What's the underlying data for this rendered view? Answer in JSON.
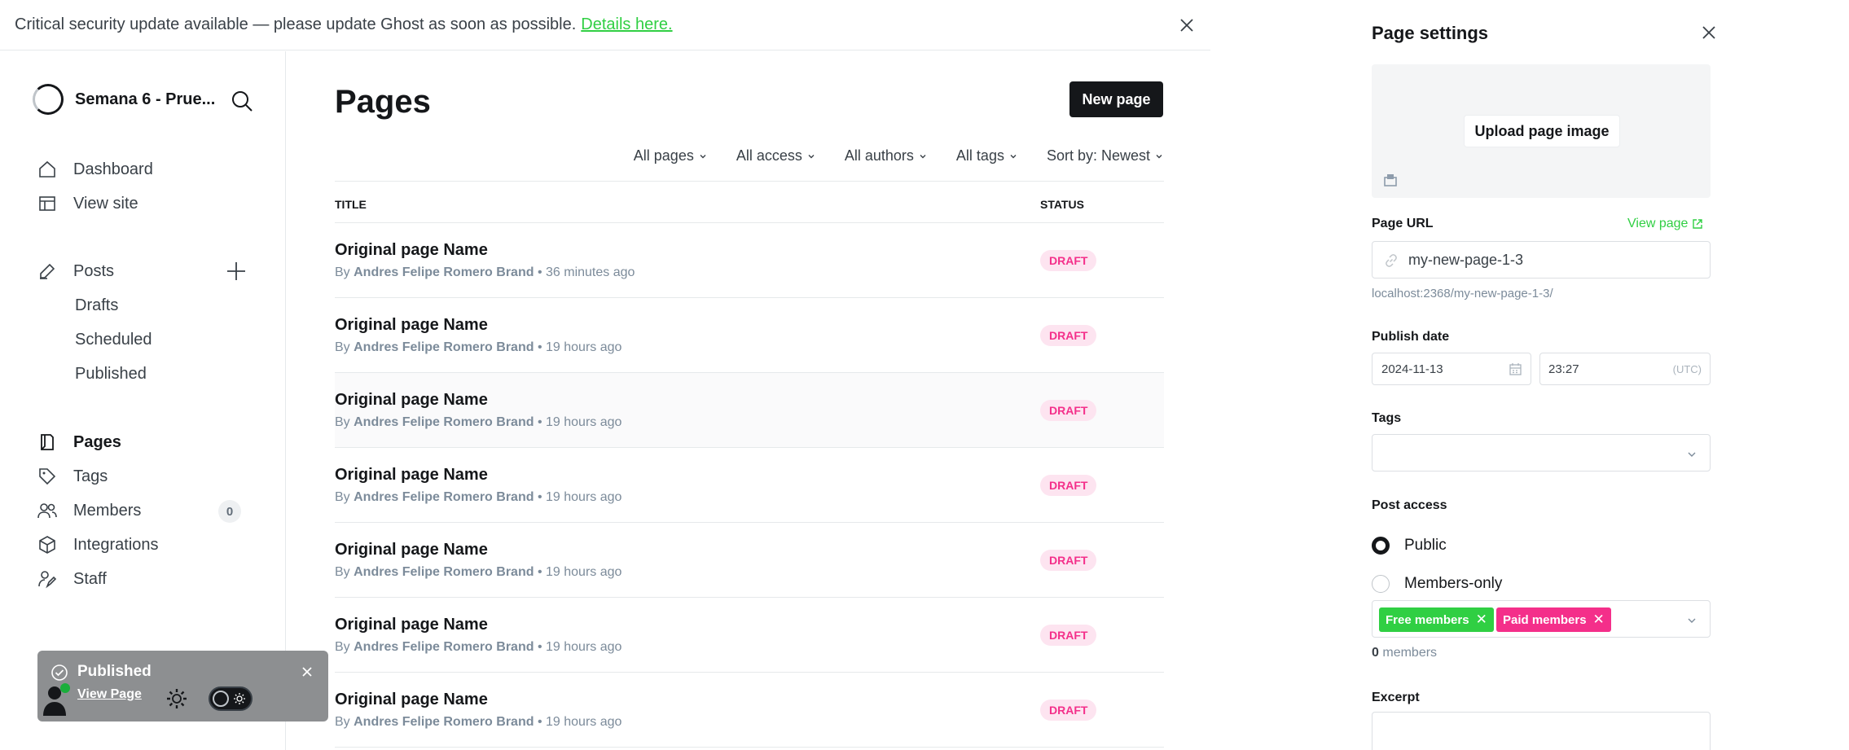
{
  "banner": {
    "text": "Critical security update available — please update Ghost as soon as possible.",
    "link": "Details here."
  },
  "sidebar": {
    "site_name": "Semana 6 - Prue...",
    "items": [
      {
        "label": "Dashboard",
        "icon": "home-icon"
      },
      {
        "label": "View site",
        "icon": "browser-icon"
      },
      {
        "label": "Posts",
        "icon": "pen-icon"
      },
      {
        "label": "Drafts"
      },
      {
        "label": "Scheduled"
      },
      {
        "label": "Published"
      },
      {
        "label": "Pages",
        "icon": "page-icon"
      },
      {
        "label": "Tags",
        "icon": "tag-icon"
      },
      {
        "label": "Members",
        "icon": "members-icon",
        "count": "0"
      },
      {
        "label": "Integrations",
        "icon": "box-icon"
      },
      {
        "label": "Staff",
        "icon": "staff-icon"
      }
    ]
  },
  "toast": {
    "title": "Published",
    "link": "View Page"
  },
  "main": {
    "title": "Pages",
    "new_page": "New page",
    "filters": [
      "All pages",
      "All access",
      "All authors",
      "All tags",
      "Sort by: Newest"
    ],
    "columns": {
      "title": "TITLE",
      "status": "STATUS"
    },
    "rows": [
      {
        "title": "Original page Name",
        "by": "By",
        "author": "Andres Felipe Romero Brand",
        "time": "• 36 minutes ago",
        "status": "DRAFT"
      },
      {
        "title": "Original page Name",
        "by": "By",
        "author": "Andres Felipe Romero Brand",
        "time": "• 19 hours ago",
        "status": "DRAFT"
      },
      {
        "title": "Original page Name",
        "by": "By",
        "author": "Andres Felipe Romero Brand",
        "time": "• 19 hours ago",
        "status": "DRAFT"
      },
      {
        "title": "Original page Name",
        "by": "By",
        "author": "Andres Felipe Romero Brand",
        "time": "• 19 hours ago",
        "status": "DRAFT"
      },
      {
        "title": "Original page Name",
        "by": "By",
        "author": "Andres Felipe Romero Brand",
        "time": "• 19 hours ago",
        "status": "DRAFT"
      },
      {
        "title": "Original page Name",
        "by": "By",
        "author": "Andres Felipe Romero Brand",
        "time": "• 19 hours ago",
        "status": "DRAFT"
      },
      {
        "title": "Original page Name",
        "by": "By",
        "author": "Andres Felipe Romero Brand",
        "time": "• 19 hours ago",
        "status": "DRAFT"
      }
    ]
  },
  "panel": {
    "title": "Page settings",
    "upload": "Upload page image",
    "url_label": "Page URL",
    "view_page": "View page",
    "url_value": "my-new-page-1-3",
    "url_hint": "localhost:2368/my-new-page-1-3/",
    "publish_label": "Publish date",
    "date": "2024-11-13",
    "time": "23:27",
    "tz": "(UTC)",
    "tags_label": "Tags",
    "access_label": "Post access",
    "access_public": "Public",
    "access_members": "Members-only",
    "chip_free": "Free members",
    "chip_paid": "Paid members",
    "members_count": "0",
    "members_suffix": "members",
    "excerpt_label": "Excerpt"
  },
  "colors": {
    "accent": "#30cf43",
    "pink": "#f42f8a",
    "draft_bg": "#fde4f0",
    "dark": "#15171a"
  }
}
